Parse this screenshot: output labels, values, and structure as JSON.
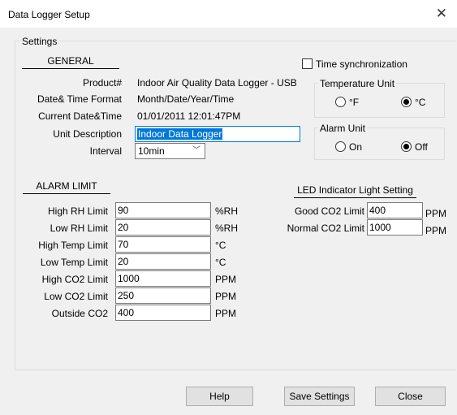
{
  "window": {
    "title": "Data Logger Setup",
    "close_glyph": "✕"
  },
  "settings_group": {
    "label": "Settings"
  },
  "general": {
    "heading": "GENERAL",
    "product_label": "Product#",
    "product_value": "Indoor Air Quality Data Logger - USB",
    "datetime_format_label": "Date& Time Format",
    "datetime_format_value": "Month/Date/Year/Time",
    "current_datetime_label": "Current Date&Time",
    "current_datetime_value": "01/01/2011 12:01:47PM",
    "unit_description_label": "Unit Description",
    "unit_description_value": "Indoor Data Logger",
    "interval_label": "Interval",
    "interval_value": "10min"
  },
  "time_sync": {
    "label": "Time synchronization",
    "checked": false
  },
  "temperature_unit": {
    "label": "Temperature Unit",
    "options": [
      "°F",
      "°C"
    ],
    "selected": "°C"
  },
  "alarm_unit": {
    "label": "Alarm Unit",
    "options": [
      "On",
      "Off"
    ],
    "selected": "Off"
  },
  "alarm_limit": {
    "heading": "ALARM LIMIT",
    "rows": [
      {
        "label": "High RH Limit",
        "value": "90",
        "unit": "%RH"
      },
      {
        "label": "Low RH Limit",
        "value": "20",
        "unit": "%RH"
      },
      {
        "label": "High Temp Limit",
        "value": "70",
        "unit": "°C"
      },
      {
        "label": "Low Temp Limit",
        "value": "20",
        "unit": "°C"
      },
      {
        "label": "High CO2 Limit",
        "value": "1000",
        "unit": "PPM"
      },
      {
        "label": "Low CO2 Limit",
        "value": "250",
        "unit": "PPM"
      },
      {
        "label": "Outside CO2",
        "value": "400",
        "unit": "PPM"
      }
    ]
  },
  "led": {
    "heading": "LED Indicator Light Setting",
    "rows": [
      {
        "label": "Good CO2 Limit",
        "value": "400",
        "unit": "PPM"
      },
      {
        "label": "Normal CO2 Limit",
        "value": "1000",
        "unit": "PPM"
      }
    ]
  },
  "buttons": {
    "help": "Help",
    "save": "Save Settings",
    "close": "Close"
  }
}
